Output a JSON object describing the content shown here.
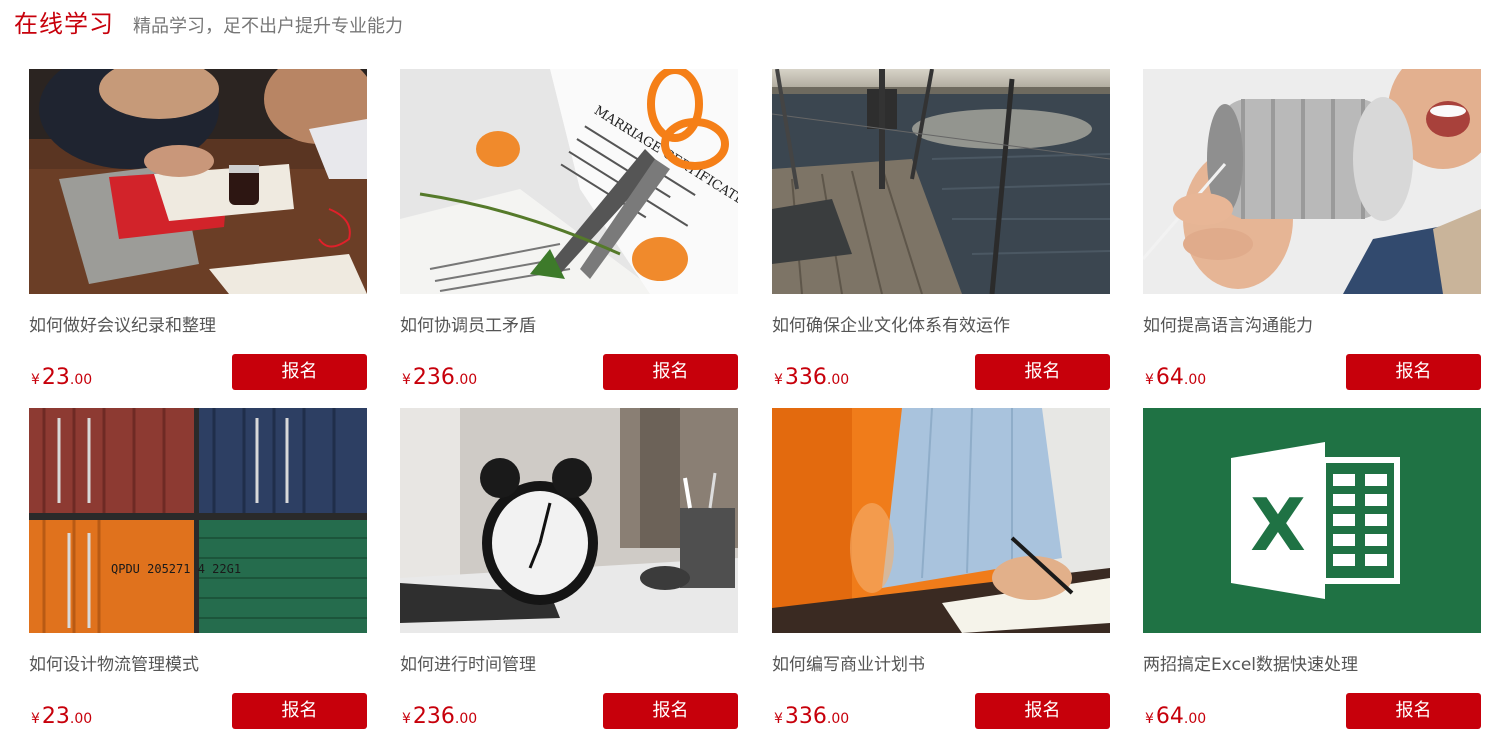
{
  "header": {
    "title": "在线学习",
    "subtitle": "精品学习，足不出户提升专业能力"
  },
  "colors": {
    "accent": "#c7000b",
    "text": "#555555"
  },
  "courses": [
    {
      "title": "如何做好会议纪录和整理",
      "currency": "¥",
      "price_int": "23",
      "price_dec": ".00",
      "button": "报名",
      "image": "meeting-notes-photo"
    },
    {
      "title": "如何协调员工矛盾",
      "currency": "¥",
      "price_int": "236",
      "price_dec": ".00",
      "button": "报名",
      "image": "torn-marriage-certificate-photo",
      "image_text": "MARRIAGE CERTIFICATE"
    },
    {
      "title": "如何确保企业文化体系有效运作",
      "currency": "¥",
      "price_int": "336",
      "price_dec": ".00",
      "button": "报名",
      "image": "sailboat-deck-photo"
    },
    {
      "title": "如何提高语言沟通能力",
      "currency": "¥",
      "price_int": "64",
      "price_dec": ".00",
      "button": "报名",
      "image": "tin-can-phone-photo"
    },
    {
      "title": "如何设计物流管理模式",
      "currency": "¥",
      "price_int": "23",
      "price_dec": ".00",
      "button": "报名",
      "image": "shipping-containers-photo",
      "image_text": "QPDU 205271 4 22G1"
    },
    {
      "title": "如何进行时间管理",
      "currency": "¥",
      "price_int": "236",
      "price_dec": ".00",
      "button": "报名",
      "image": "alarm-clock-photo"
    },
    {
      "title": "如何编写商业计划书",
      "currency": "¥",
      "price_int": "336",
      "price_dec": ".00",
      "button": "报名",
      "image": "man-writing-photo"
    },
    {
      "title": "两招搞定Excel数据快速处理",
      "currency": "¥",
      "price_int": "64",
      "price_dec": ".00",
      "button": "报名",
      "image": "excel-logo",
      "image_text": "X"
    }
  ]
}
